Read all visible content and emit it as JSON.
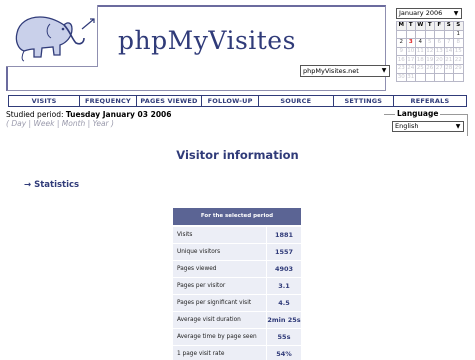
{
  "app": {
    "title": "phpMyVisites",
    "site": "phpMyVisites.net"
  },
  "calendar": {
    "month": "January 2006",
    "weekdays": [
      "M",
      "T",
      "W",
      "T",
      "F",
      "S",
      "S"
    ],
    "weeks": [
      [
        "",
        "",
        "",
        "",
        "",
        "",
        "1"
      ],
      [
        "2",
        "3",
        "4",
        "5",
        "6",
        "7",
        "8"
      ],
      [
        "9",
        "10",
        "11",
        "12",
        "13",
        "14",
        "15"
      ],
      [
        "16",
        "17",
        "18",
        "19",
        "20",
        "21",
        "22"
      ],
      [
        "23",
        "24",
        "25",
        "26",
        "27",
        "28",
        "29"
      ],
      [
        "30",
        "31",
        "",
        "",
        "",
        "",
        ""
      ]
    ],
    "selected_day": "3"
  },
  "menu": [
    {
      "label": "Visits"
    },
    {
      "label": "Frequency"
    },
    {
      "label": "Pages viewed"
    },
    {
      "label": "Follow-up"
    },
    {
      "label": "Source"
    },
    {
      "label": "Settings"
    },
    {
      "label": "Referals"
    }
  ],
  "period": {
    "prefix": "Studied period:",
    "date": "Tuesday January 03 2006",
    "open": "(",
    "options": [
      "Day",
      "Week",
      "Month",
      "Year"
    ],
    "sep": "|",
    "close": ")"
  },
  "language": {
    "title": "Language",
    "selected": "English"
  },
  "main": {
    "title": "Visitor information",
    "section": "→ Statistics"
  },
  "stats": {
    "header": "For the selected period",
    "rows": [
      {
        "label": "Visits",
        "value": "1881"
      },
      {
        "label": "Unique visitors",
        "value": "1557"
      },
      {
        "label": "Pages viewed",
        "value": "4903"
      },
      {
        "label": "Pages per visitor",
        "value": "3.1"
      },
      {
        "label": "Pages per significant visit",
        "value": "4.5"
      },
      {
        "label": "Average visit duration",
        "value": "2min 25s"
      },
      {
        "label": "Average time by page seen",
        "value": "55s"
      },
      {
        "label": "1 page visit rate",
        "value": "54%"
      }
    ]
  }
}
